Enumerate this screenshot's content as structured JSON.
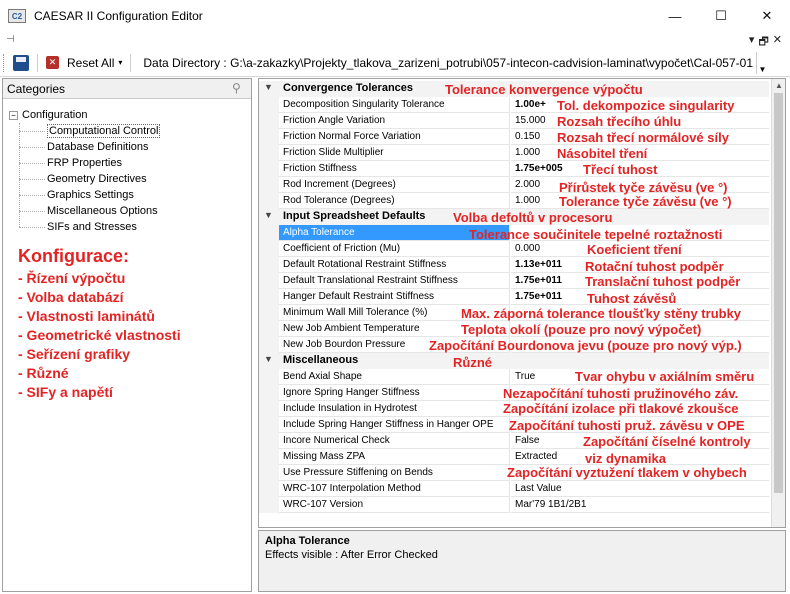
{
  "window": {
    "title": "CAESAR II Configuration Editor",
    "icon_text": "C2",
    "minimize_glyph": "—",
    "maximize_glyph": "☐",
    "close_glyph": "✕"
  },
  "mdi": {
    "pin_glyph": "⊣",
    "dropdown_glyph": "▾",
    "restore_glyph": "🗗",
    "close_glyph": "✕"
  },
  "toolbar": {
    "reset_label": "Reset All",
    "reset_arrow": "▾",
    "data_directory": "Data Directory : G:\\a-zakazky\\Projekty_tlakova_zarizeni_potrubi\\057-intecon-cadvision-laminat\\vypočet\\Cal-057-01\\"
  },
  "categories": {
    "header": "Categories",
    "root": "Configuration",
    "items": [
      "Computational Control",
      "Database Definitions",
      "FRP Properties",
      "Geometry Directives",
      "Graphics Settings",
      "Miscellaneous Options",
      "SIFs and Stresses"
    ]
  },
  "left_annotations": {
    "title": "Konfigurace:",
    "lines": [
      "- Řízení výpočtu",
      "- Volba databází",
      "- Vlastnosti laminátů",
      "- Geometrické vlastnosti",
      "- Seřízení grafiky",
      "- Různé",
      "- SIFy a napětí"
    ]
  },
  "grid": {
    "sections": {
      "convergence": "Convergence Tolerances",
      "spreadsheet": "Input Spreadsheet Defaults",
      "misc": "Miscellaneous"
    },
    "convergence_rows": [
      {
        "name": "Decomposition Singularity Tolerance",
        "value": "1.00e+",
        "bold": true
      },
      {
        "name": "Friction Angle Variation",
        "value": "15.000",
        "bold": false
      },
      {
        "name": "Friction Normal Force Variation",
        "value": "0.150",
        "bold": false
      },
      {
        "name": "Friction Slide Multiplier",
        "value": "1.000",
        "bold": false
      },
      {
        "name": "Friction Stiffness",
        "value": "1.75e+005",
        "bold": true
      },
      {
        "name": "Rod Increment (Degrees)",
        "value": "2.000",
        "bold": false
      },
      {
        "name": "Rod Tolerance (Degrees)",
        "value": "1.000",
        "bold": false
      }
    ],
    "spreadsheet_rows": [
      {
        "name": "Alpha Tolerance",
        "value": "",
        "bold": false
      },
      {
        "name": "Coefficient of Friction (Mu)",
        "value": "0.000",
        "bold": false
      },
      {
        "name": "Default Rotational Restraint Stiffness",
        "value": "1.13e+011",
        "bold": true
      },
      {
        "name": "Default Translational Restraint Stiffness",
        "value": "1.75e+011",
        "bold": true
      },
      {
        "name": "Hanger Default Restraint Stiffness",
        "value": "1.75e+011",
        "bold": true
      },
      {
        "name": "Minimum Wall Mill Tolerance (%)",
        "value": "",
        "bold": false
      },
      {
        "name": "New Job Ambient Temperature",
        "value": "",
        "bold": false
      },
      {
        "name": "New Job Bourdon Pressure",
        "value": "",
        "bold": false
      }
    ],
    "misc_rows": [
      {
        "name": "Bend Axial Shape",
        "value": "True",
        "bold": false
      },
      {
        "name": "Ignore Spring Hanger Stiffness",
        "value": "",
        "bold": false
      },
      {
        "name": "Include Insulation in Hydrotest",
        "value": "",
        "bold": false
      },
      {
        "name": "Include Spring Hanger Stiffness in Hanger OPE",
        "value": "",
        "bold": false
      },
      {
        "name": "Incore Numerical Check",
        "value": "False",
        "bold": false
      },
      {
        "name": "Missing Mass ZPA",
        "value": "Extracted",
        "bold": false
      },
      {
        "name": "Use Pressure Stiffening on Bends",
        "value": "",
        "bold": false
      },
      {
        "name": "WRC-107 Interpolation Method",
        "value": "Last Value",
        "bold": false
      },
      {
        "name": "WRC-107 Version",
        "value": "Mar'79 1B1/2B1",
        "bold": false
      }
    ]
  },
  "annotations": {
    "convergence": "Tolerance konvergence výpočtu",
    "decomp": "Tol. dekompozice singularity",
    "friction_angle": "Rozsah třecího úhlu",
    "friction_normal": "Rozsah třecí normálové síly",
    "slide": "Násobitel tření",
    "stiffness": "Třecí tuhost",
    "rod_inc": "Přírůstek tyče závěsu (ve  °)",
    "rod_tol": "Tolerance tyče závěsu (ve °)",
    "spreadsheet": "Volba defoltů v procesoru",
    "alpha": "Tolerance součinitele tepelné roztažnosti",
    "mu": "Koeficient tření",
    "rot": "Rotační tuhost podpěr",
    "trans": "Translační tuhost podpěr",
    "hanger": "Tuhost závěsů",
    "mill": "Max. záporná tolerance tloušťky stěny trubky",
    "ambient": "Teplota okolí (pouze pro nový výpočet)",
    "bourdon": "Započítání Bourdonova jevu (pouze pro nový výp.)",
    "misc": "Různé",
    "bend": "Tvar ohybu v axiálním směru",
    "ignore_spring": "Nezapočítání tuhosti pružinového záv.",
    "insulation": "Započítání  izolace při tlakové zkoušce",
    "spring_ope": "Započítání tuhosti  pruž. závěsu v OPE",
    "incore": "Započítání číselné kontroly",
    "zpa": "viz dynamika",
    "pressure_stiff": "Započítání vyztužení tlakem v ohybech"
  },
  "description": {
    "title": "Alpha Tolerance",
    "text": "Effects visible : After Error Checked"
  }
}
